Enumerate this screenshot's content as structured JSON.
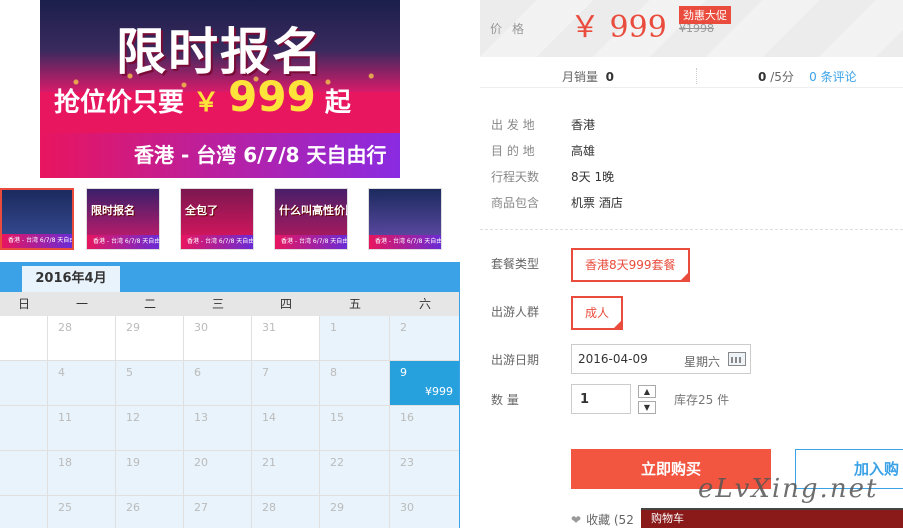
{
  "banner": {
    "title": "限时报名",
    "line_prefix": "抢位价只要",
    "line_yen": "￥",
    "line_price": "999",
    "line_suffix": "起",
    "route": "香港 - 台湾 6/7/8 天自由行"
  },
  "thumbnails": [
    {
      "text": "",
      "bar": "香港 - 台湾 6/7/8 天自由行",
      "bg": "#2a3d7a",
      "active": true
    },
    {
      "text": "限时报名",
      "bar": "香港 - 台湾 6/7/8 天自由行",
      "bg": "#6b2a8a",
      "active": false
    },
    {
      "text": "全包了",
      "bar": "香港 - 台湾 6/7/8 天自由行",
      "bg": "#c0185a",
      "active": false
    },
    {
      "text": "什么叫高性价比?",
      "bar": "香港 - 台湾 6/7/8 天自由行",
      "bg": "#7a1f6a",
      "active": false
    },
    {
      "text": "",
      "bar": "香港 - 台湾 6/7/8 天自由行",
      "bg": "#2a4a8a",
      "active": false
    }
  ],
  "calendar": {
    "month_label": "2016年4月",
    "weekdays": [
      "日",
      "一",
      "二",
      "三",
      "四",
      "五",
      "六"
    ],
    "rows": [
      [
        "",
        "28",
        "29",
        "30",
        "31",
        "1",
        "2"
      ],
      [
        "",
        "4",
        "5",
        "6",
        "7",
        "8",
        "9"
      ],
      [
        "",
        "11",
        "12",
        "13",
        "14",
        "15",
        "16"
      ],
      [
        "",
        "18",
        "19",
        "20",
        "21",
        "22",
        "23"
      ],
      [
        "",
        "25",
        "26",
        "27",
        "28",
        "29",
        "30"
      ]
    ],
    "selected_price": "¥999"
  },
  "price": {
    "label": "价格",
    "value": "￥ 999",
    "badge": "劲惠大促",
    "old": "¥1998"
  },
  "stats": {
    "monthly_sales_label": "月销量",
    "monthly_sales_value": "0",
    "rating_value": "0",
    "rating_suffix": "/5分",
    "review_count": "0",
    "review_suffix": "条评论"
  },
  "info": [
    {
      "key": "出 发 地",
      "value": "香港"
    },
    {
      "key": "目 的 地",
      "value": "高雄"
    },
    {
      "key": "行程天数",
      "value": "8天 1晚"
    },
    {
      "key": "商品包含",
      "value": "机票  酒店"
    }
  ],
  "options": {
    "package_label": "套餐类型",
    "package_value": "香港8天999套餐",
    "crowd_label": "出游人群",
    "crowd_value": "成人",
    "date_label": "出游日期",
    "date_value": "2016-04-09",
    "weekday_value": "星期六",
    "qty_label": "数  量",
    "qty_value": "1",
    "qty_up": "▲",
    "qty_down": "▼",
    "stock": "库存25 件"
  },
  "actions": {
    "buy": "立即购买",
    "cart": "加入购",
    "favorite": "收藏 (52",
    "cart_tip": "购物车"
  },
  "watermark": "eLvXing.net",
  "colors": {
    "accent": "#e94b3c",
    "blue": "#3ba2e8",
    "buy": "#f25540"
  }
}
